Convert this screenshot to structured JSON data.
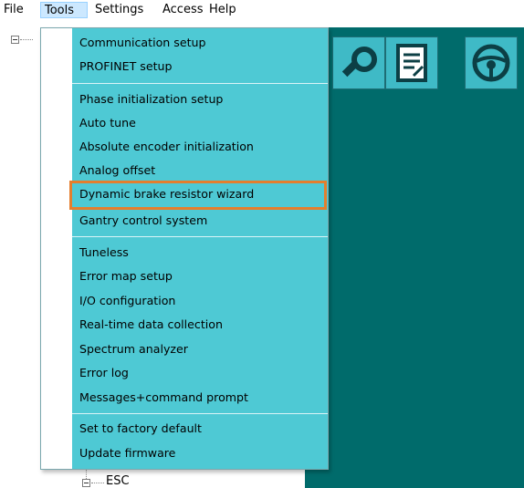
{
  "menubar": {
    "items": [
      {
        "label": "File"
      },
      {
        "label": "Tools"
      },
      {
        "label": "Settings"
      },
      {
        "label": "Access"
      },
      {
        "label": "Help"
      }
    ]
  },
  "tools_menu": {
    "groups": [
      [
        "Communication setup",
        "PROFINET setup"
      ],
      [
        "Phase initialization setup",
        "Auto tune",
        "Absolute encoder initialization",
        "Analog offset",
        "Dynamic brake resistor wizard",
        "Gantry control system"
      ],
      [
        "Tuneless",
        "Error map setup",
        "I/O configuration",
        "Real-time data collection",
        "Spectrum analyzer",
        "Error log",
        "Messages+command prompt"
      ],
      [
        "Set to factory default",
        "Update firmware"
      ]
    ],
    "highlighted_item": "Dynamic brake resistor wizard"
  },
  "tree": {
    "bottom_node_label": "ESC"
  },
  "toolbar": {
    "icons": [
      "wrench-gear-icon",
      "document-icon",
      "steering-wheel-icon"
    ]
  },
  "colors": {
    "menu_background": "#4ec9d4",
    "workarea_background": "#006b6b",
    "highlight_border": "#e47e2d",
    "toolbar_button": "#3fbac6"
  }
}
